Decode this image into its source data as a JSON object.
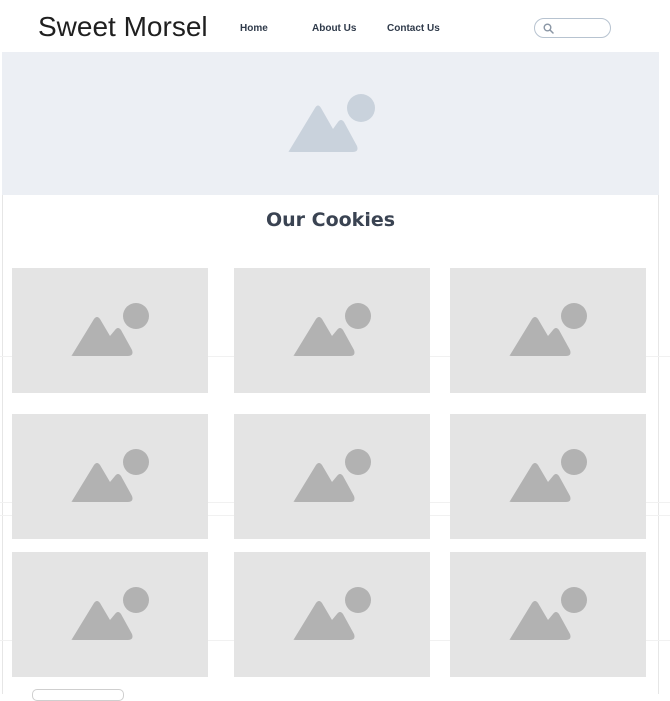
{
  "brand": {
    "name": "Sweet Morsel"
  },
  "nav": {
    "items": [
      {
        "label": "Home"
      },
      {
        "label": "About Us"
      },
      {
        "label": "Contact Us"
      }
    ]
  },
  "search": {
    "placeholder": "",
    "icon": "search-icon"
  },
  "hero": {
    "image": "image-placeholder-icon"
  },
  "section": {
    "title": "Our Cookies"
  },
  "products": {
    "count_shown": 9,
    "image": "image-placeholder-icon"
  },
  "colors": {
    "hero_bg": "#eceff4",
    "card_bg": "#e4e4e4",
    "placeholder_icon": "#b2b2b2",
    "hero_icon": "#c9d2dc",
    "title": "#3a4352"
  }
}
